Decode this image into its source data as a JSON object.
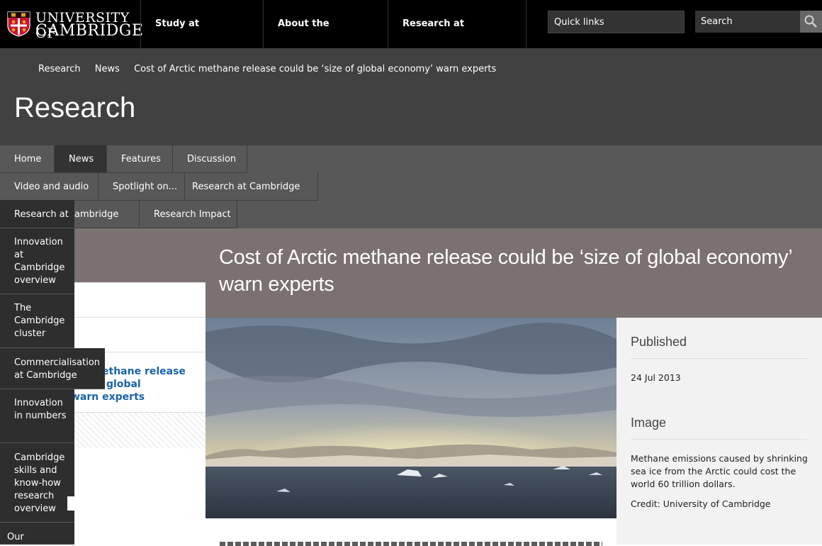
{
  "header": {
    "logo_line1": "UNIVERSITY OF",
    "logo_line2": "CAMBRIDGE",
    "nav": [
      "Study at Cambridge",
      "About the University",
      "Research at Cambridge"
    ],
    "quick_links_label": "Quick links",
    "search_placeholder": "Search"
  },
  "breadcrumb": [
    "Research",
    "News",
    "Cost of Arctic methane release could be ‘size of global economy’ warn experts"
  ],
  "site_title": "Research",
  "local_nav": {
    "row1": [
      "Home",
      "News",
      "Features",
      "Discussion"
    ],
    "row2": [
      "Video and audio",
      "Spotlight on...",
      "Research at Cambridge"
    ],
    "row3": [
      "ambridge",
      "Research Impact"
    ],
    "active": "News"
  },
  "dropdown": [
    "Research at",
    "Innovation at Cambridge overview",
    "The Cambridge cluster",
    "Commercialisation at Cambridge",
    "Innovation in numbers",
    "Cambridge skills and know-how",
    "research overview",
    "Our"
  ],
  "article": {
    "title": "Cost of Arctic methane release could be ‘size of global economy’ warn experts",
    "left_link": "ethane release\nglobal\nwarn experts"
  },
  "sidebar": {
    "published_heading": "Published",
    "published_date": "24 Jul 2013",
    "image_heading": "Image",
    "image_caption": "Methane emissions caused by shrinking sea ice from the Arctic could cost the world 60 trillion dollars.",
    "image_credit": "Credit: University of Cambridge"
  },
  "colors": {
    "header_bg": "#000000",
    "band_bg": "#414141",
    "nav_bg": "#585858",
    "hero_bg": "#7a7170",
    "link": "#1a63a8"
  }
}
